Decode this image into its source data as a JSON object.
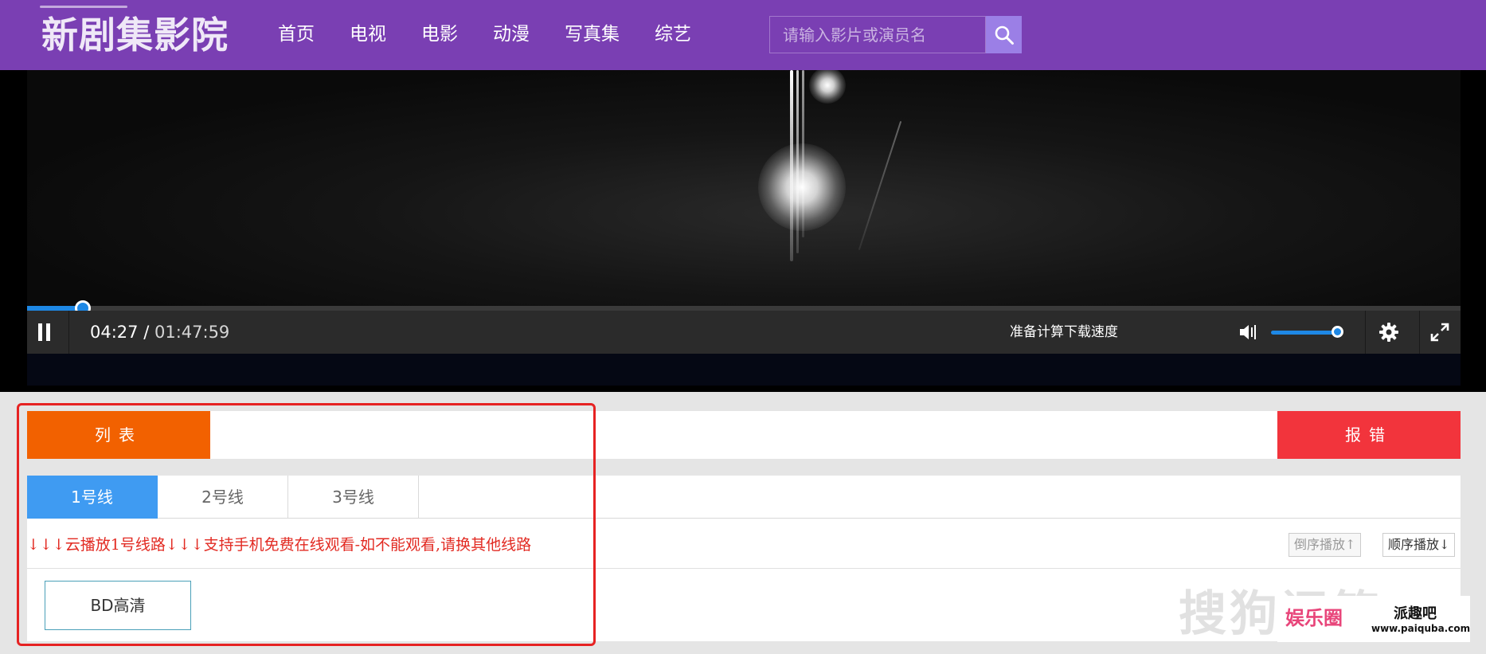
{
  "header": {
    "logo_text": "新剧集影院",
    "nav": [
      {
        "label": "首页"
      },
      {
        "label": "电视"
      },
      {
        "label": "电影"
      },
      {
        "label": "动漫"
      },
      {
        "label": "写真集"
      },
      {
        "label": "综艺"
      }
    ],
    "search": {
      "placeholder": "请输入影片或演员名",
      "icon": "search-icon"
    },
    "bg_color": "#7a3fb3"
  },
  "player": {
    "current_time": "04:27",
    "time_separator": " / ",
    "total_time": "01:47:59",
    "progress_fraction": 0.041,
    "speed_text": "准备计算下载速度",
    "volume_fraction": 1.0,
    "icons": [
      "pause-icon",
      "volume-icon",
      "settings-icon",
      "fullscreen-icon"
    ],
    "accent_color": "#1e88e5"
  },
  "panel": {
    "list_label": "列表",
    "report_label": "报错",
    "tabs": [
      {
        "label": "1号线",
        "active": true
      },
      {
        "label": "2号线",
        "active": false
      },
      {
        "label": "3号线",
        "active": false
      }
    ],
    "notice": "↓↓↓云播放1号线路↓↓↓支持手机免费在线观看-如不能观看,请换其他线路",
    "sort_desc_label": "倒序播放↑",
    "sort_asc_label": "顺序播放↓",
    "episodes": [
      {
        "label": "BD高清"
      }
    ]
  },
  "watermark": {
    "sogou_text": "搜狗问答",
    "brand_left": "娱乐圈",
    "brand_right": "派趣吧",
    "brand_url": "www.paiquba.com"
  }
}
